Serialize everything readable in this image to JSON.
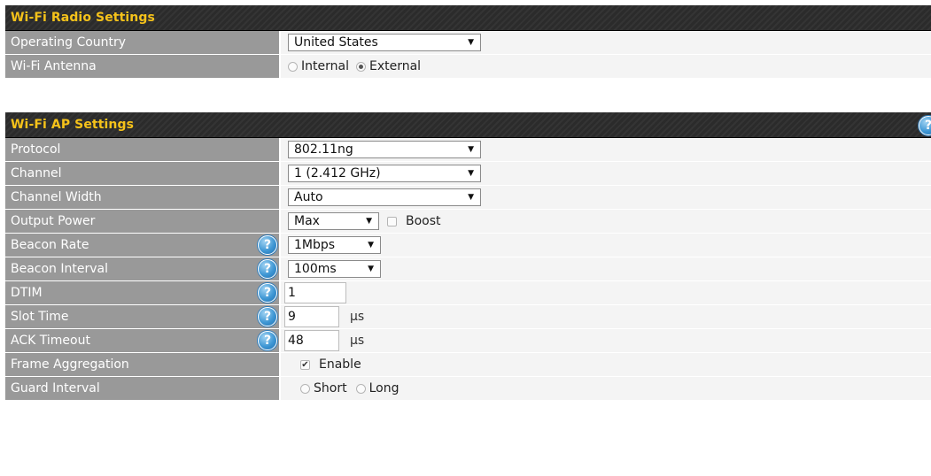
{
  "radio_panel": {
    "title": "Wi-Fi Radio Settings",
    "operating_country": {
      "label": "Operating Country",
      "value": "United States"
    },
    "wifi_antenna": {
      "label": "Wi-Fi Antenna",
      "options": [
        "Internal",
        "External"
      ],
      "selected": "External"
    }
  },
  "ap_panel": {
    "title": "Wi-Fi AP Settings",
    "help_glyph": "?",
    "protocol": {
      "label": "Protocol",
      "value": "802.11ng"
    },
    "channel": {
      "label": "Channel",
      "value": "1 (2.412 GHz)"
    },
    "channel_width": {
      "label": "Channel Width",
      "value": "Auto"
    },
    "output_power": {
      "label": "Output Power",
      "value": "Max",
      "boost_label": "Boost",
      "boost_checked": false
    },
    "beacon_rate": {
      "label": "Beacon Rate",
      "value": "1Mbps"
    },
    "beacon_interval": {
      "label": "Beacon Interval",
      "value": "100ms"
    },
    "dtim": {
      "label": "DTIM",
      "value": "1"
    },
    "slot_time": {
      "label": "Slot Time",
      "value": "9",
      "unit": "μs"
    },
    "ack_timeout": {
      "label": "ACK Timeout",
      "value": "48",
      "unit": "μs"
    },
    "frame_aggregation": {
      "label": "Frame Aggregation",
      "option_label": "Enable",
      "checked": true
    },
    "guard_interval": {
      "label": "Guard Interval",
      "options": [
        "Short",
        "Long"
      ],
      "selected": null
    }
  },
  "icons": {
    "help": "question-circle-icon",
    "dropdown": "caret-down-icon",
    "checkmark_glyph": "✔",
    "caret_glyph": "▼"
  },
  "colors": {
    "header_bg": "#2b2b2b",
    "header_text": "#f5c21a",
    "label_bg": "#999999",
    "value_bg": "#f4f4f4",
    "help_blue": "#3f97d4"
  }
}
